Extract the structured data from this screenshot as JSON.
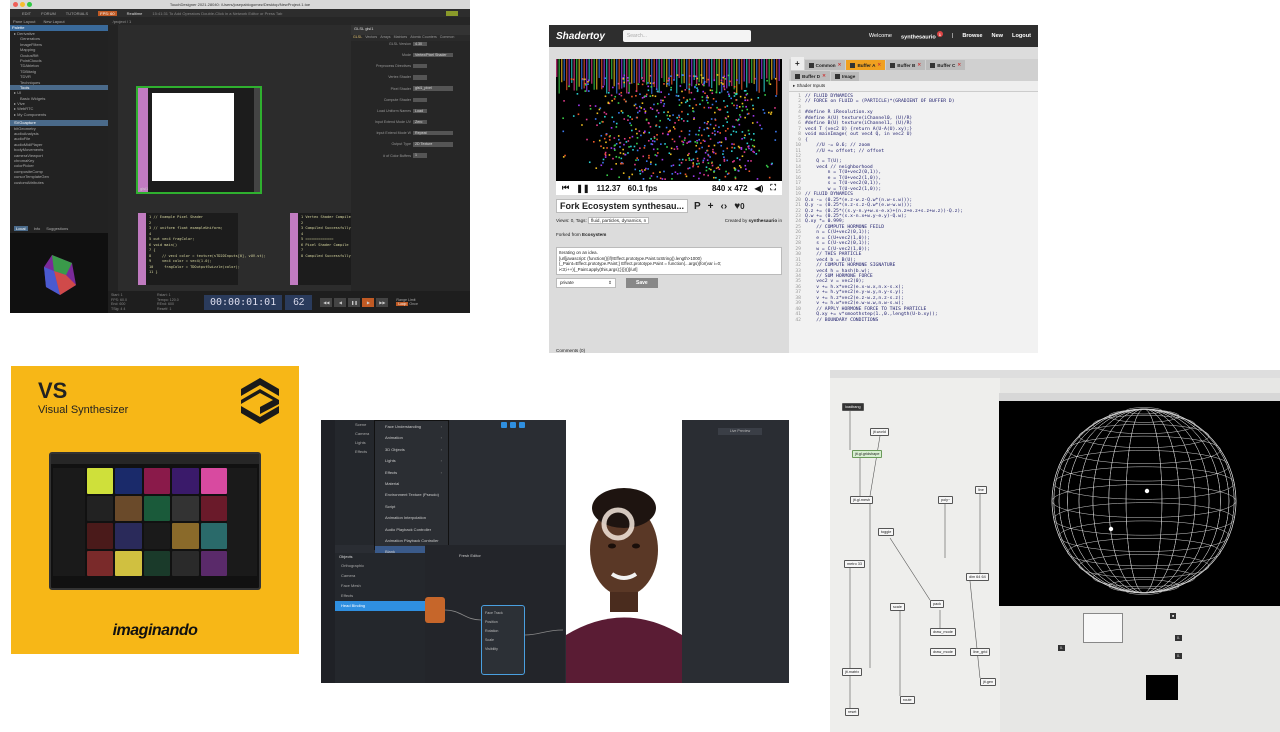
{
  "touchdesigner": {
    "window_title": "TouchDesigner 2021.28040: /Users/josepablogomez/Desktop/NewProject.1.toe",
    "menu": [
      "EDIT",
      "FORUM",
      "TUTORIALS"
    ],
    "fps_label": "FPS: 60",
    "realtime": "Realtime",
    "hint": "15:41:31 To Add Operators Double-Click in a Network Editor or Press Tab",
    "toolbar": [
      "Pane Layout",
      "New Layout"
    ],
    "path": "/project / 1",
    "palette_header": "Palette",
    "palette_items": [
      "Derivative",
      "Generators",
      "ImageFilters",
      "Mapping",
      "OculusRift",
      "PointClouds",
      "TDAbleton",
      "TDBitwig",
      "TDVR",
      "Techniques",
      "Tools",
      "UI",
      "Basic Widgets",
      "Vive",
      "WebRTC",
      "My Components"
    ],
    "op_items": [
      "SVGcapture",
      "bitGeometry",
      "audioAnalysis",
      "audioFile",
      "audioMidiPlayer",
      "bodyMovements",
      "cameraViewport",
      "chromaKey",
      "colorPicker",
      "compositeComp",
      "cursorTemplateGen",
      "customAttributes"
    ],
    "palette_tabs": [
      "Local",
      "Info",
      "Suggestions"
    ],
    "node_name": "glsl1",
    "shader_code": [
      "// Example Pixel Shader",
      "",
      "// uniform float exampleUniform;",
      "",
      "out vec4 fragColor;",
      "void main()",
      "{",
      "    // vec4 color = texture(sTD2DInputs[0], vUV.st);",
      "    vec4 color = vec4(1.0);",
      "    fragColor = TDOutputSwizzle(color);",
      "}"
    ],
    "compile_results": [
      "Vertex Shader Compile Results:",
      "",
      "Compiled Successfully",
      "",
      "=============",
      "Pixel Shader Compile Results:",
      "",
      "Compiled Successfully"
    ],
    "params_header": "GLSL  glsl1",
    "params_tabs": [
      "GLSL",
      "Vectors",
      "Arrays",
      "Matrices",
      "Atomic Counters",
      "Common"
    ],
    "params": [
      {
        "k": "GLSL Version",
        "v": "4.30"
      },
      {
        "k": "Mode",
        "v": "Vertex/Pixel Shader"
      },
      {
        "k": "Preprocess Directives",
        "v": ""
      },
      {
        "k": "Vertex Shader",
        "v": ""
      },
      {
        "k": "Pixel Shader",
        "v": "glsl1_pixel"
      },
      {
        "k": "Compute Shader",
        "v": ""
      },
      {
        "k": "Load Uniform Names",
        "v": "Load"
      },
      {
        "k": "Input Extend Mode UV",
        "v": "Zero"
      },
      {
        "k": "Input Extend Mode W",
        "v": "Repeat"
      },
      {
        "k": "Output Type",
        "v": "2D Texture"
      },
      {
        "k": "# of Color Buffers",
        "v": "1"
      }
    ],
    "stats": [
      "Start: 1",
      "Rstart: 1",
      "FPS: 60.0",
      "Tempo: 120.0",
      "End: 600",
      "REnd: 600",
      "TSig: 4 4",
      "Resetf: 1"
    ],
    "timecode": "00:00:01:01",
    "fps_value": "62",
    "range_limit": "Range Limit",
    "range_opts": [
      "Loop",
      "Once"
    ]
  },
  "shadertoy": {
    "logo": "Shadertoy",
    "search_placeholder": "Search...",
    "welcome": "Welcome",
    "user": "synthesaurio",
    "badge": "1",
    "nav": [
      "Browse",
      "New",
      "Logout"
    ],
    "time": "112.37",
    "fps": "60.1 fps",
    "resolution": "840 x 472",
    "shader_title": "Fork Ecosystem synthesau...",
    "views": "Views: 0, Tags:",
    "tags": "fluid, particles, dynamics, n",
    "created_by": "Created by",
    "author": "synthesaurio",
    "author_suffix": "in",
    "forked_from": "Forked from",
    "forked_name": "Ecosystem",
    "likes": "0",
    "description": [
      "Iterating on an idea.",
      "[url]javascript:  (function(){if(!Effect.prototype.Paint.toString().length>1000)",
      "{_Paint=Effect.prototype.Paint;} Effect.prototype.Paint = function(...args){for(var i=0;",
      "i<3;i++){_Paint.apply(this,args);}}})()[/url]"
    ],
    "visibility": "private",
    "save": "Save",
    "comments": "Comments (0)",
    "tabs": [
      "Common",
      "Buffer A",
      "Buffer B",
      "Buffer C"
    ],
    "tabs2": [
      "Buffer D",
      "Image"
    ],
    "shader_inputs": "Shader Inputs",
    "code": [
      "// FLUID DYNAMICS",
      "// FORCE on FLUID = (PARTICLE)*(GRADIENT OF BUFFER D)",
      "",
      "#define R iResolution.xy",
      "#define A(U) texture(iChannel0, (U)/R)",
      "#define B(U) texture(iChannel1, (U)/R)",
      "vec4 T (vec2 U) {return A(U-A(U).xy);}",
      "void mainImage( out vec4 Q, in vec2 U)",
      "{",
      "    //U -= 0.6; // zoom",
      "    //U += offset; // offset",
      "",
      "    Q = T(U);",
      "    vec4 // neighborhood",
      "        n = T(U+vec2(0,1)),",
      "        e = T(U+vec2(1,0)),",
      "        s = T(U-vec2(0,1)),",
      "        w = T(U-vec2(1,0));",
      "// FLUID DYNAMICS",
      "Q.x -= (0.25*(e.z-w.z-Q.w*(n.w-s.w)));",
      "Q.y -= (0.25*(n.z-s.z-Q.w*(e.w-w.w)));",
      "Q.z += (0.25*((s.y-n.y+w.x-e.x)+(n.z+e.z+s.z+w.z))-Q.z);",
      "Q.w += (0.25*(s.x-n.x+w.y-e.y)-Q.w);",
      "Q.xy *= 0.999;",
      "    // COMPUTE HORMONE FEILD",
      "    n = C(U+vec2(0,1));",
      "    e = C(U+vec2(1,0));",
      "    s = C(U-vec2(0,1));",
      "    w = C(U-vec2(1,0));",
      "    // THIS PARTICLE",
      "    vec4 b = B(U);",
      "    // COMPUTE HORMONE SIGNATURE",
      "    vec4 h = hash(b.w);",
      "    // SUM HORMONE FORCE",
      "    vec2 v = vec2(0);",
      "    v += h.x*vec2(e.x-w.x,n.x-s.x);",
      "    v += h.y*vec2(e.y-w.y,n.y-s.y);",
      "    v += h.z*vec2(e.z-w.z,n.z-s.z);",
      "    v += h.w*vec2(e.w-w.w,n.w-s.w);",
      "    // APPLY HORMONE FORCE TO THIS PARTICLE",
      "    Q.xy += v*smoothstep(1.,0.,length(U-b.xy));",
      "    // BOUNDARY CONDITIONS"
    ]
  },
  "visual_synth": {
    "title": "VS",
    "subtitle": "Visual Synthesizer",
    "brand": "imaginando"
  },
  "lens_studio": {
    "menu": [
      "Face Understanding",
      "Animation",
      "3D Objects",
      "Lights",
      "Effects",
      "Material",
      "Environment Texture (Pseudo)",
      "Script",
      "Animation Interpolation",
      "Audio Playback Controller",
      "Animation Playback Controller",
      "Blank"
    ],
    "scene_rows": [
      "Scene",
      "Camera",
      "Lights",
      "Effects"
    ],
    "objects_header": "Objects",
    "objects": [
      "Orthographic",
      "Camera",
      "Face Mesh",
      "Effects",
      "Head Binding"
    ],
    "graph_title": "Fresh Editor",
    "node_rows": [
      "Face Track",
      "Position",
      "Rotation",
      "Scale",
      "Visibility"
    ],
    "right_button": "Live Preview"
  },
  "max": {
    "objects": [
      "loadbang",
      "jit.world",
      "jit.gl.gridshape",
      "jit.gl.mesh",
      "poly~",
      "metro 33",
      "toggle",
      "line",
      "draw_mode",
      "jit.matrix",
      "dim 64 64",
      "scale",
      "pack",
      "route",
      "jit.gen",
      "reset"
    ],
    "draw_mode": "draw_mode",
    "line_grid": "line_grid"
  }
}
